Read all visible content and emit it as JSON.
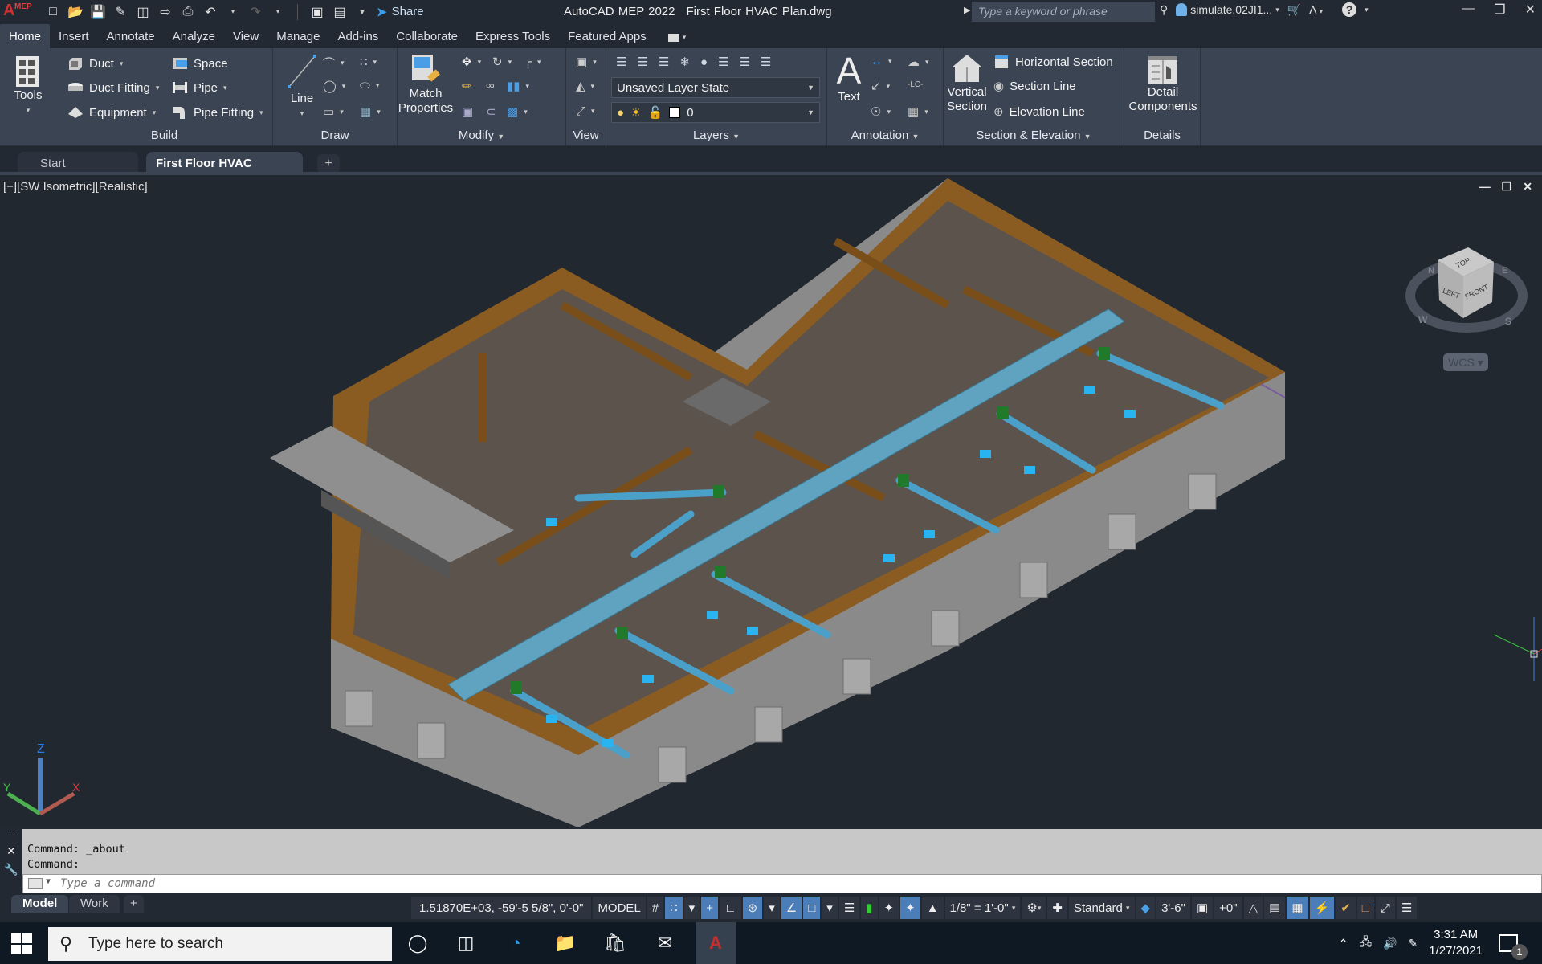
{
  "titlebar": {
    "app_name": "AutoCAD MEP 2022",
    "file_name": "First Floor HVAC Plan.dwg",
    "share_label": "Share",
    "search_placeholder": "Type a keyword or phrase",
    "user_name": "simulate.02JI1...",
    "logo_text": "A",
    "logo_sup": "MEP"
  },
  "ribbon_tabs": [
    "Home",
    "Insert",
    "Annotate",
    "Analyze",
    "View",
    "Manage",
    "Add-ins",
    "Collaborate",
    "Express Tools",
    "Featured Apps"
  ],
  "ribbon": {
    "tools": {
      "label": "Tools"
    },
    "build": {
      "title": "Build",
      "items": {
        "duct": "Duct",
        "duct_fitting": "Duct Fitting",
        "equipment": "Equipment",
        "space": "Space",
        "pipe": "Pipe",
        "pipe_fitting": "Pipe Fitting"
      }
    },
    "draw": {
      "title": "Draw",
      "line": "Line"
    },
    "modify": {
      "title": "Modify",
      "match_properties_1": "Match",
      "match_properties_2": "Properties"
    },
    "view": {
      "title": "View"
    },
    "layers": {
      "title": "Layers",
      "layer_state": "Unsaved Layer State",
      "current_layer": "0"
    },
    "annotation": {
      "title": "Annotation",
      "text": "Text",
      "lc": "-LC-"
    },
    "section_elevation": {
      "title": "Section & Elevation",
      "vertical_1": "Vertical",
      "vertical_2": "Section",
      "horizontal": "Horizontal Section",
      "section_line": "Section Line",
      "elevation_line": "Elevation Line"
    },
    "details": {
      "title": "Details",
      "detail_1": "Detail",
      "detail_2": "Components"
    }
  },
  "doc_tabs": {
    "start": "Start",
    "active": "First Floor HVAC Plan*"
  },
  "viewport": {
    "label": "[−][SW Isometric][Realistic]",
    "viewcube": {
      "top": "TOP",
      "left": "LEFT",
      "front": "FRONT",
      "n": "N",
      "e": "E",
      "w": "W",
      "s": "S"
    },
    "wcs": "WCS",
    "ucs": {
      "x": "X",
      "y": "Y",
      "z": "Z"
    }
  },
  "command_line": {
    "history": [
      "Command: _about",
      "Command:"
    ],
    "placeholder": "Type a command"
  },
  "layout_tabs": [
    "Model",
    "Work",
    "+"
  ],
  "status_bar": {
    "coordinates": "1.51870E+03, -59'-5 5/8\", 0'-0\"",
    "space": "MODEL",
    "scale": "1/8\" = 1'-0\"",
    "style": "Standard",
    "elevation": "3'-6\"",
    "offset": "+0\""
  },
  "taskbar": {
    "search_placeholder": "Type here to search",
    "time": "3:31 AM",
    "date": "1/27/2021",
    "notification_count": "1"
  }
}
